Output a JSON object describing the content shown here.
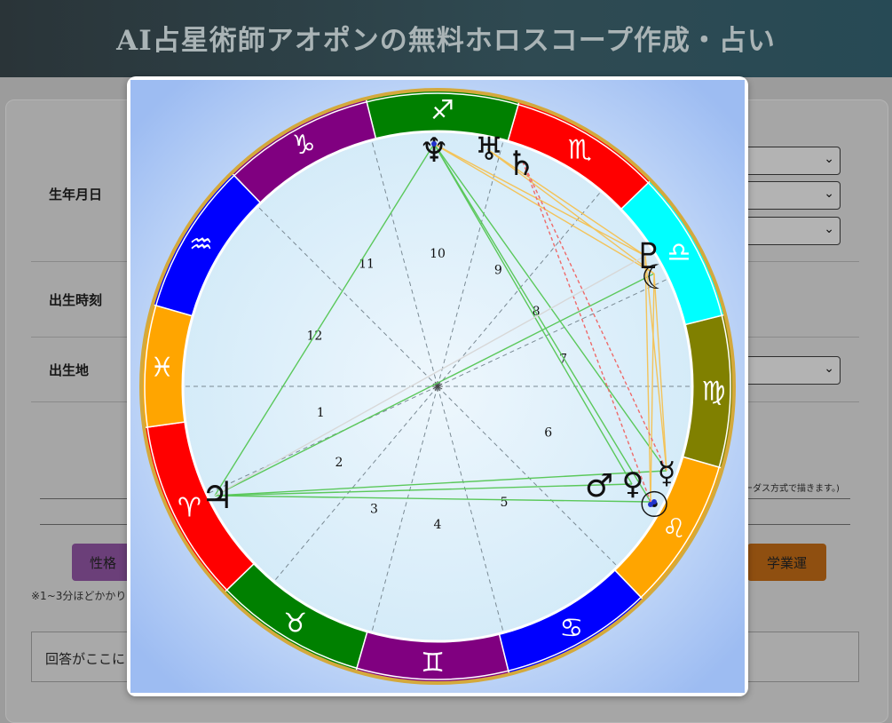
{
  "header": {
    "title": "AI占星術師アオポンの無料ホロスコープ作成・占い"
  },
  "form": {
    "birth_date_label": "生年月日",
    "birth_time_label": "出生時刻",
    "birth_place_label": "出生地",
    "chart_note": "ーダス方式で描きます。)"
  },
  "buttons": {
    "personality": "性格",
    "study_luck": "学業運"
  },
  "note": "※1~3分ほどかかり",
  "answer_placeholder": "回答がここに",
  "chart": {
    "signs": [
      "♈",
      "♉",
      "♊",
      "♋",
      "♌",
      "♍",
      "♎",
      "♏",
      "♐",
      "♑",
      "♒",
      "♓"
    ],
    "sign_colors": [
      "#ff0000",
      "#008000",
      "#800080",
      "#0000ff",
      "#ffa500",
      "#808000",
      "#00ffff",
      "#ff0000",
      "#008000",
      "#800080",
      "#0000ff",
      "#ffa500"
    ],
    "houses": [
      "1",
      "2",
      "3",
      "4",
      "5",
      "6",
      "7",
      "8",
      "9",
      "10",
      "11",
      "12"
    ],
    "planets": {
      "neptune": "♆",
      "uranus": "♅",
      "saturn": "♄",
      "pluto": "♇",
      "moon": "☾",
      "mercury": "☿",
      "venus": "♀",
      "mars": "♂",
      "sun": "☉",
      "jupiter": "♃"
    }
  }
}
